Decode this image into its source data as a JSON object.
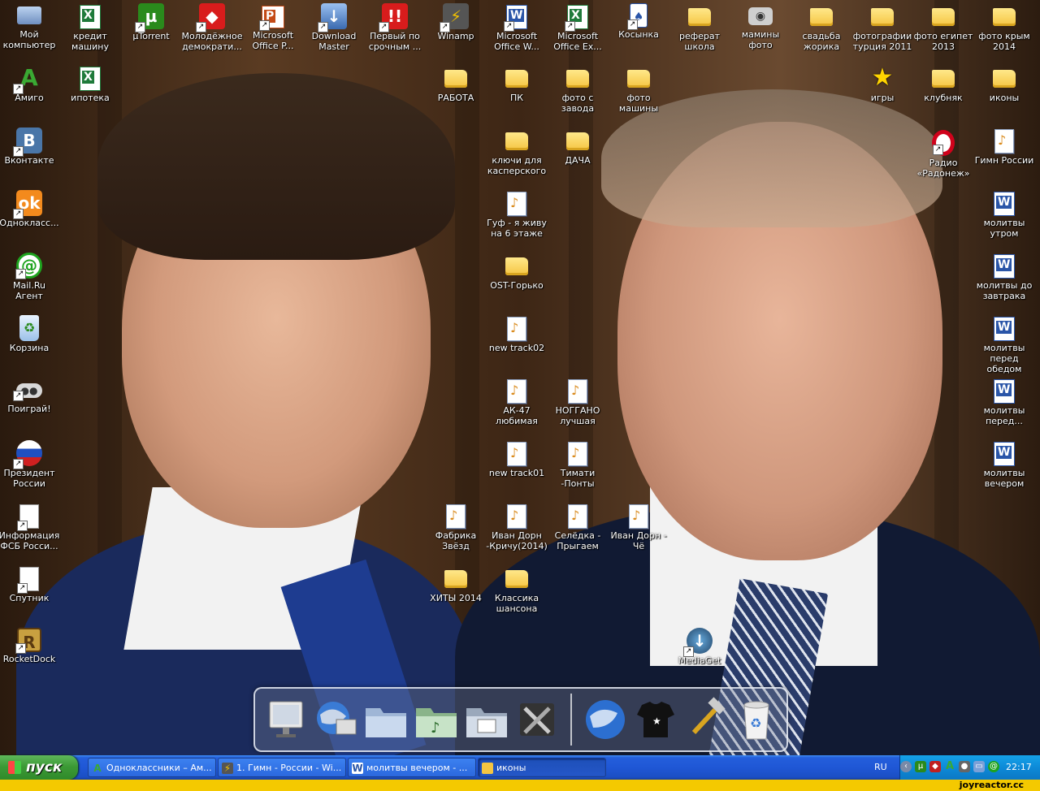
{
  "desktop": {
    "icons": [
      {
        "id": "my-computer",
        "label": "Мой компьютер",
        "kind": "pc"
      },
      {
        "id": "credit",
        "label": "кредит машину",
        "kind": "excel"
      },
      {
        "id": "utorrent",
        "label": "µTorrent",
        "kind": "utorrent"
      },
      {
        "id": "molodezhnoe",
        "label": "Молодёжное демократи...",
        "kind": "red"
      },
      {
        "id": "ms-office-p",
        "label": "Microsoft Office P...",
        "kind": "ppt"
      },
      {
        "id": "download-master",
        "label": "Download Master",
        "kind": "download"
      },
      {
        "id": "perviy",
        "label": "Первый по срочным ...",
        "kind": "red"
      },
      {
        "id": "winamp",
        "label": "Winamp",
        "kind": "winamp"
      },
      {
        "id": "ms-office-w",
        "label": "Microsoft Office W...",
        "kind": "word"
      },
      {
        "id": "ms-office-ex",
        "label": "Microsoft Office Ex...",
        "kind": "excel"
      },
      {
        "id": "kosynka",
        "label": "Косынка",
        "kind": "kosynka"
      },
      {
        "id": "referat",
        "label": "реферат школа",
        "kind": "folder"
      },
      {
        "id": "maminy-foto",
        "label": "мамины фото",
        "kind": "camera"
      },
      {
        "id": "svadba",
        "label": "свадьба жорика",
        "kind": "folder"
      },
      {
        "id": "foto-turciya",
        "label": "фотографии турция 2011",
        "kind": "folder"
      },
      {
        "id": "foto-egipet",
        "label": "фото египет 2013",
        "kind": "folder"
      },
      {
        "id": "foto-krym",
        "label": "фото крым 2014",
        "kind": "folder"
      },
      {
        "id": "amigo",
        "label": "Амиго",
        "kind": "amigo"
      },
      {
        "id": "ipoteka",
        "label": "ипотека",
        "kind": "excel"
      },
      {
        "id": "rabota",
        "label": "РАБОТА",
        "kind": "folder"
      },
      {
        "id": "pk",
        "label": "ПК",
        "kind": "folder"
      },
      {
        "id": "foto-zavoda",
        "label": "фото с завода",
        "kind": "folder"
      },
      {
        "id": "foto-mashiny",
        "label": "фото машины",
        "kind": "folder"
      },
      {
        "id": "igry",
        "label": "игры",
        "kind": "star"
      },
      {
        "id": "klubnyak",
        "label": "клубняк",
        "kind": "folder"
      },
      {
        "id": "ikony",
        "label": "иконы",
        "kind": "folder"
      },
      {
        "id": "vkontakte",
        "label": "Вконтакте",
        "kind": "vk"
      },
      {
        "id": "klyuchi",
        "label": "ключи для касперского",
        "kind": "folder"
      },
      {
        "id": "dacha",
        "label": "ДАЧА",
        "kind": "folder"
      },
      {
        "id": "radio",
        "label": "Радио «Радонеж»",
        "kind": "opera"
      },
      {
        "id": "gimn",
        "label": "Гимн России",
        "kind": "doc"
      },
      {
        "id": "odnoklassniki",
        "label": "Однокласс...",
        "kind": "ok"
      },
      {
        "id": "guf",
        "label": "Гуф - я живу на 6 этаже",
        "kind": "doc"
      },
      {
        "id": "molitvy-utrom",
        "label": "молитвы утром",
        "kind": "word"
      },
      {
        "id": "mailru",
        "label": "Mail.Ru Агент",
        "kind": "mail"
      },
      {
        "id": "ost-gorko",
        "label": "OST-Горько",
        "kind": "folder"
      },
      {
        "id": "molitvy-do-zavtraka",
        "label": "молитвы до завтрака",
        "kind": "word"
      },
      {
        "id": "korzina",
        "label": "Корзина",
        "kind": "recycle"
      },
      {
        "id": "new-track02",
        "label": "new track02",
        "kind": "doc"
      },
      {
        "id": "molitvy-pered-obedom",
        "label": "молитвы перед обедом",
        "kind": "word"
      },
      {
        "id": "poigray",
        "label": "Поиграй!",
        "kind": "game"
      },
      {
        "id": "ak47",
        "label": "АК-47 любимая",
        "kind": "doc"
      },
      {
        "id": "noggano",
        "label": "НОГГАНО лучшая",
        "kind": "doc"
      },
      {
        "id": "molitvy-pered",
        "label": "молитвы перед...",
        "kind": "word"
      },
      {
        "id": "prezident",
        "label": "Президент России",
        "kind": "flag"
      },
      {
        "id": "new-track01",
        "label": "new track01",
        "kind": "doc"
      },
      {
        "id": "timati",
        "label": "Тимати -Понты",
        "kind": "doc"
      },
      {
        "id": "molitvy-vecherom",
        "label": "молитвы вечером",
        "kind": "word"
      },
      {
        "id": "informaciya-fsb",
        "label": "Информация ФСБ Росси...",
        "kind": "file"
      },
      {
        "id": "fabrika",
        "label": "Фабрика Звёзд",
        "kind": "doc"
      },
      {
        "id": "ivan-dorn-krichu",
        "label": "Иван Дорн -Кричу(2014)",
        "kind": "doc"
      },
      {
        "id": "selyodka",
        "label": "Селёдка - Прыгаем",
        "kind": "doc"
      },
      {
        "id": "ivan-dorn-che",
        "label": "Иван Дорн - Чё",
        "kind": "doc"
      },
      {
        "id": "sputnik",
        "label": "Спутник",
        "kind": "sputnik"
      },
      {
        "id": "hity",
        "label": "ХИТЫ 2014",
        "kind": "folder"
      },
      {
        "id": "klassika",
        "label": "Классика шансона",
        "kind": "folder"
      },
      {
        "id": "rocketdock",
        "label": "RocketDock",
        "kind": "rocket"
      },
      {
        "id": "mediaget",
        "label": "MediaGet",
        "kind": "mediaget"
      }
    ]
  },
  "dock": {
    "items": [
      "monitor-icon",
      "globe-monitor-icon",
      "folder-icon",
      "music-folder-icon",
      "images-folder-icon",
      "tools-icon",
      "globe-icon",
      "tshirt-icon",
      "hammer-icon",
      "recycle-bin-icon"
    ]
  },
  "taskbar": {
    "start_label": "пуск",
    "tasks": [
      {
        "label": "Одноклассники – Ам...",
        "icon": "amigo-icon"
      },
      {
        "label": "1. Гимн - России - Wi...",
        "icon": "winamp-icon"
      },
      {
        "label": "молитвы вечером - ...",
        "icon": "word-icon"
      },
      {
        "label": "иконы",
        "icon": "folder-icon"
      }
    ],
    "lang": "RU",
    "clock": "22:17"
  },
  "watermark": "joyreactor.cc",
  "colors": {
    "taskbar": "#245edb",
    "start": "#3c9a36",
    "tray": "#0d8ad8",
    "folder": "#f5c542"
  }
}
